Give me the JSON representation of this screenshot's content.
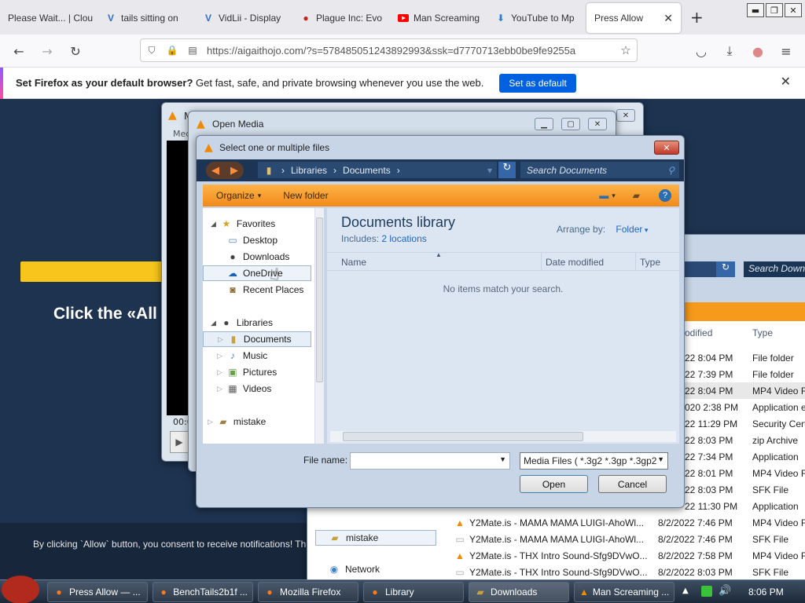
{
  "browser": {
    "tabs": [
      {
        "title": "Please Wait... | Clou",
        "icon": "cloud-icon"
      },
      {
        "title": "tails sitting on",
        "icon": "vidlii-icon"
      },
      {
        "title": "VidLii - Display",
        "icon": "vidlii-icon"
      },
      {
        "title": "Plague Inc: Evo",
        "icon": "plague-icon"
      },
      {
        "title": "Man Screaming",
        "icon": "youtube-icon"
      },
      {
        "title": "YouTube to Mp",
        "icon": "download-icon"
      },
      {
        "title": "Press Allow",
        "icon": "none"
      }
    ],
    "url": "https://aigaithojo.com/?s=578485051243892993&ssk=d7770713ebb0be9fe9255a",
    "url_domain": "aigaithojo.com"
  },
  "notification_bar": {
    "bold": "Set Firefox as your default browser?",
    "text": " Get fast, safe, and private browsing whenever you use the web.",
    "button": "Set as default"
  },
  "page": {
    "headline": "Click the «All",
    "consent": "By clicking `Allow` button, you consent to receive notifications! Th"
  },
  "vlc_main": {
    "title": "M",
    "menu": "Med",
    "time": "00:0"
  },
  "open_media": {
    "title": "Open Media"
  },
  "file_dialog": {
    "title": "Select one or multiple files",
    "breadcrumb": [
      "Libraries",
      "Documents"
    ],
    "search_placeholder": "Search Documents",
    "toolbar": {
      "organize": "Organize",
      "new_folder": "New folder"
    },
    "tree": {
      "favorites": "Favorites",
      "favorites_items": [
        "Desktop",
        "Downloads",
        "OneDrive",
        "Recent Places"
      ],
      "libraries": "Libraries",
      "libraries_items": [
        "Documents",
        "Music",
        "Pictures",
        "Videos"
      ],
      "extra": "mistake"
    },
    "library_title": "Documents library",
    "includes_label": "Includes:",
    "includes_link": "2 locations",
    "arrange_label": "Arrange by:",
    "arrange_value": "Folder",
    "columns": [
      "Name",
      "Date modified",
      "Type"
    ],
    "empty_message": "No items match your search.",
    "filename_label": "File name:",
    "filename_value": "",
    "filter": "Media Files ( *.3g2 *.3gp *.3gp2",
    "open_button": "Open",
    "cancel_button": "Cancel"
  },
  "downloads_window": {
    "search_placeholder": "Search Downlo",
    "header_date": "odified",
    "header_type": "Type",
    "rows": [
      {
        "name": "",
        "date": "22 8:04 PM",
        "type": "File folder"
      },
      {
        "name": "",
        "date": "22 7:39 PM",
        "type": "File folder"
      },
      {
        "name": "",
        "date": "22 8:04 PM",
        "type": "MP4 Video Fi"
      },
      {
        "name": "",
        "date": "020 2:38 PM",
        "type": "Application e"
      },
      {
        "name": "",
        "date": "22 11:29 PM",
        "type": "Security Cert"
      },
      {
        "name": "",
        "date": "22 8:03 PM",
        "type": "zip Archive"
      },
      {
        "name": "",
        "date": "22 7:34 PM",
        "type": "Application"
      },
      {
        "name": "",
        "date": "22 8:01 PM",
        "type": "MP4 Video Fi"
      },
      {
        "name": "",
        "date": "22 8:03 PM",
        "type": "SFK File"
      },
      {
        "name": "",
        "date": "22 11:30 PM",
        "type": "Application"
      },
      {
        "name": "Y2Mate.is - MAMA MAMA LUIGI-AhoWl...",
        "date": "8/2/2022 7:46 PM",
        "type": "MP4 Video Fi"
      },
      {
        "name": "Y2Mate.is - MAMA MAMA LUIGI-AhoWl...",
        "date": "8/2/2022 7:46 PM",
        "type": "SFK File"
      },
      {
        "name": "Y2Mate.is - THX Intro Sound-Sfg9DVwO...",
        "date": "8/2/2022 7:58 PM",
        "type": "MP4 Video Fi"
      },
      {
        "name": "Y2Mate.is - THX Intro Sound-Sfg9DVwO...",
        "date": "8/2/2022 8:03 PM",
        "type": "SFK File"
      }
    ],
    "nav_items": [
      "mistake",
      "Network"
    ]
  },
  "taskbar": {
    "items": [
      "Press Allow — ...",
      "BenchTails2b1f ...",
      "Mozilla Firefox",
      "Library",
      "Downloads",
      "Man Screaming ..."
    ],
    "clock": "8:06 PM"
  },
  "colors": {
    "accent": "#0061e0",
    "toolbar_orange": "#f59a1a",
    "dialog_blue": "#c7d5e6",
    "page_bg": "#1e3350"
  }
}
